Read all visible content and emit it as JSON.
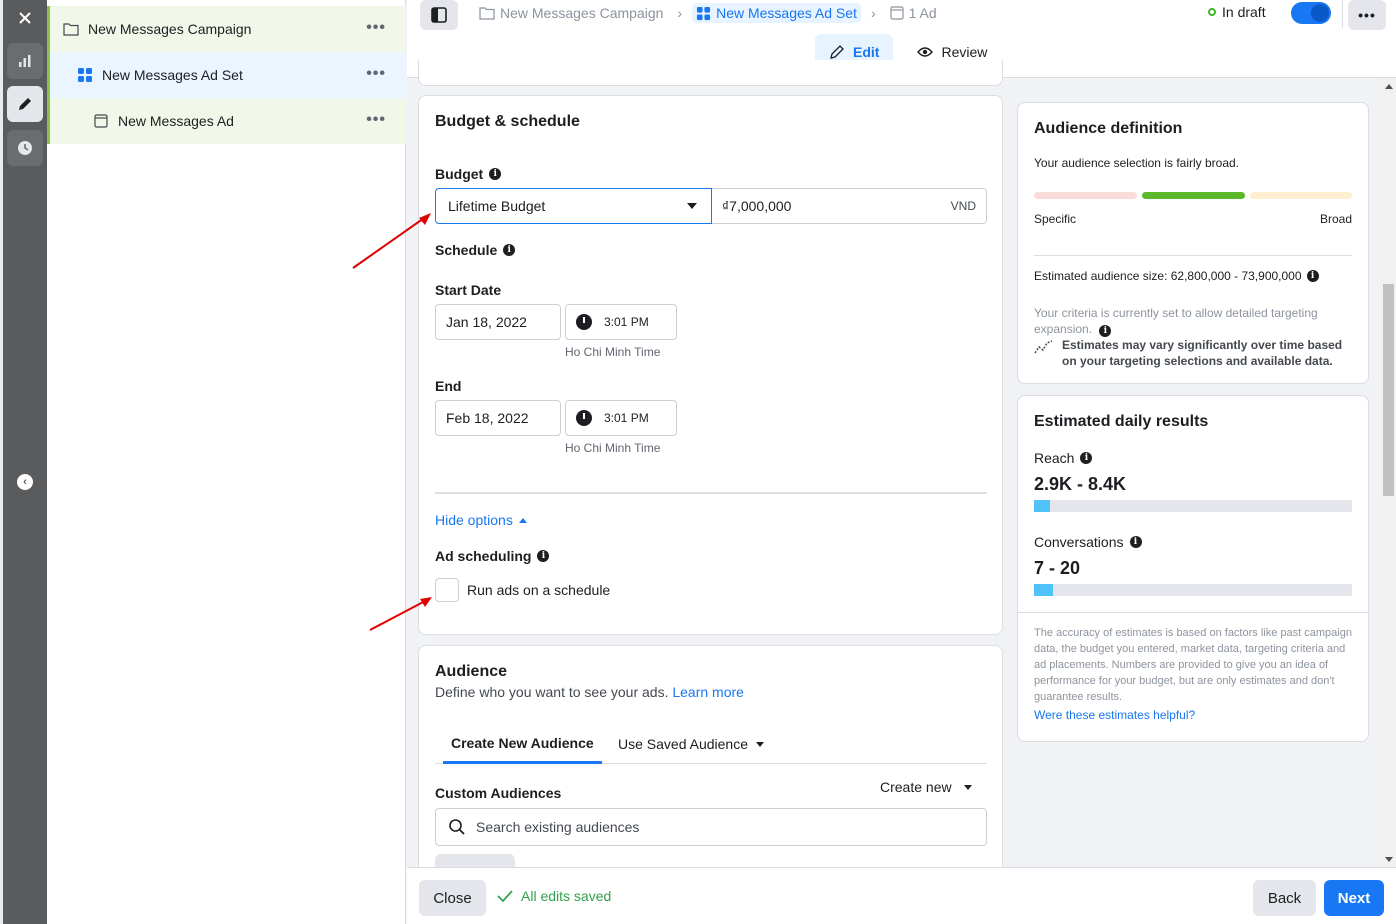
{
  "tree": {
    "campaign": "New Messages Campaign",
    "adset": "New Messages Ad Set",
    "ad": "New Messages Ad",
    "more": "•••"
  },
  "breadcrumbs": {
    "campaign": "New Messages Campaign",
    "adset": "New Messages Ad Set",
    "ad": "1 Ad"
  },
  "status": "In draft",
  "more": "•••",
  "modes": {
    "edit": "Edit",
    "review": "Review"
  },
  "budget": {
    "title": "Budget & schedule",
    "budget_label": "Budget",
    "budget_type": "Lifetime Budget",
    "amount": "₫7,000,000",
    "currency": "VND",
    "schedule_label": "Schedule",
    "start_label": "Start Date",
    "start_date": "Jan 18, 2022",
    "start_time": "3:01 PM",
    "timezone": "Ho Chi Minh Time",
    "end_label": "End",
    "end_date": "Feb 18, 2022",
    "end_time": "3:01 PM",
    "hide_options": "Hide options",
    "ad_scheduling": "Ad scheduling",
    "run_on_schedule": "Run ads on a schedule"
  },
  "audience": {
    "title": "Audience",
    "desc": "Define who you want to see your ads.",
    "learn_more": "Learn more",
    "tab_new": "Create New Audience",
    "tab_saved": "Use Saved Audience",
    "custom_label": "Custom Audiences",
    "create_new": "Create new",
    "search_placeholder": "Search existing audiences"
  },
  "audience_definition": {
    "title": "Audience definition",
    "summary": "Your audience selection is fairly broad.",
    "specific": "Specific",
    "broad": "Broad",
    "size": "Estimated audience size: 62,800,000 - 73,900,000",
    "criteria": "Your criteria is currently set to allow detailed targeting expansion.",
    "note": "Estimates may vary significantly over time based on your targeting selections and available data.",
    "colors": {
      "specific": "#fadbd8",
      "fit": "#5ab82a",
      "broad": "#fdefcf"
    }
  },
  "estimated": {
    "title": "Estimated daily results",
    "reach_label": "Reach",
    "reach_value": "2.9K - 8.4K",
    "reach_fill": 0.05,
    "conv_label": "Conversations",
    "conv_value": "7 - 20",
    "conv_fill": 0.06,
    "disclaimer": "The accuracy of estimates is based on factors like past campaign data, the budget you entered, market data, targeting criteria and ad placements. Numbers are provided to give you an idea of performance for your budget, but are only estimates and don't guarantee results.",
    "helpful": "Were these estimates helpful?"
  },
  "footer": {
    "close": "Close",
    "saved": "All edits saved",
    "back": "Back",
    "next": "Next"
  }
}
